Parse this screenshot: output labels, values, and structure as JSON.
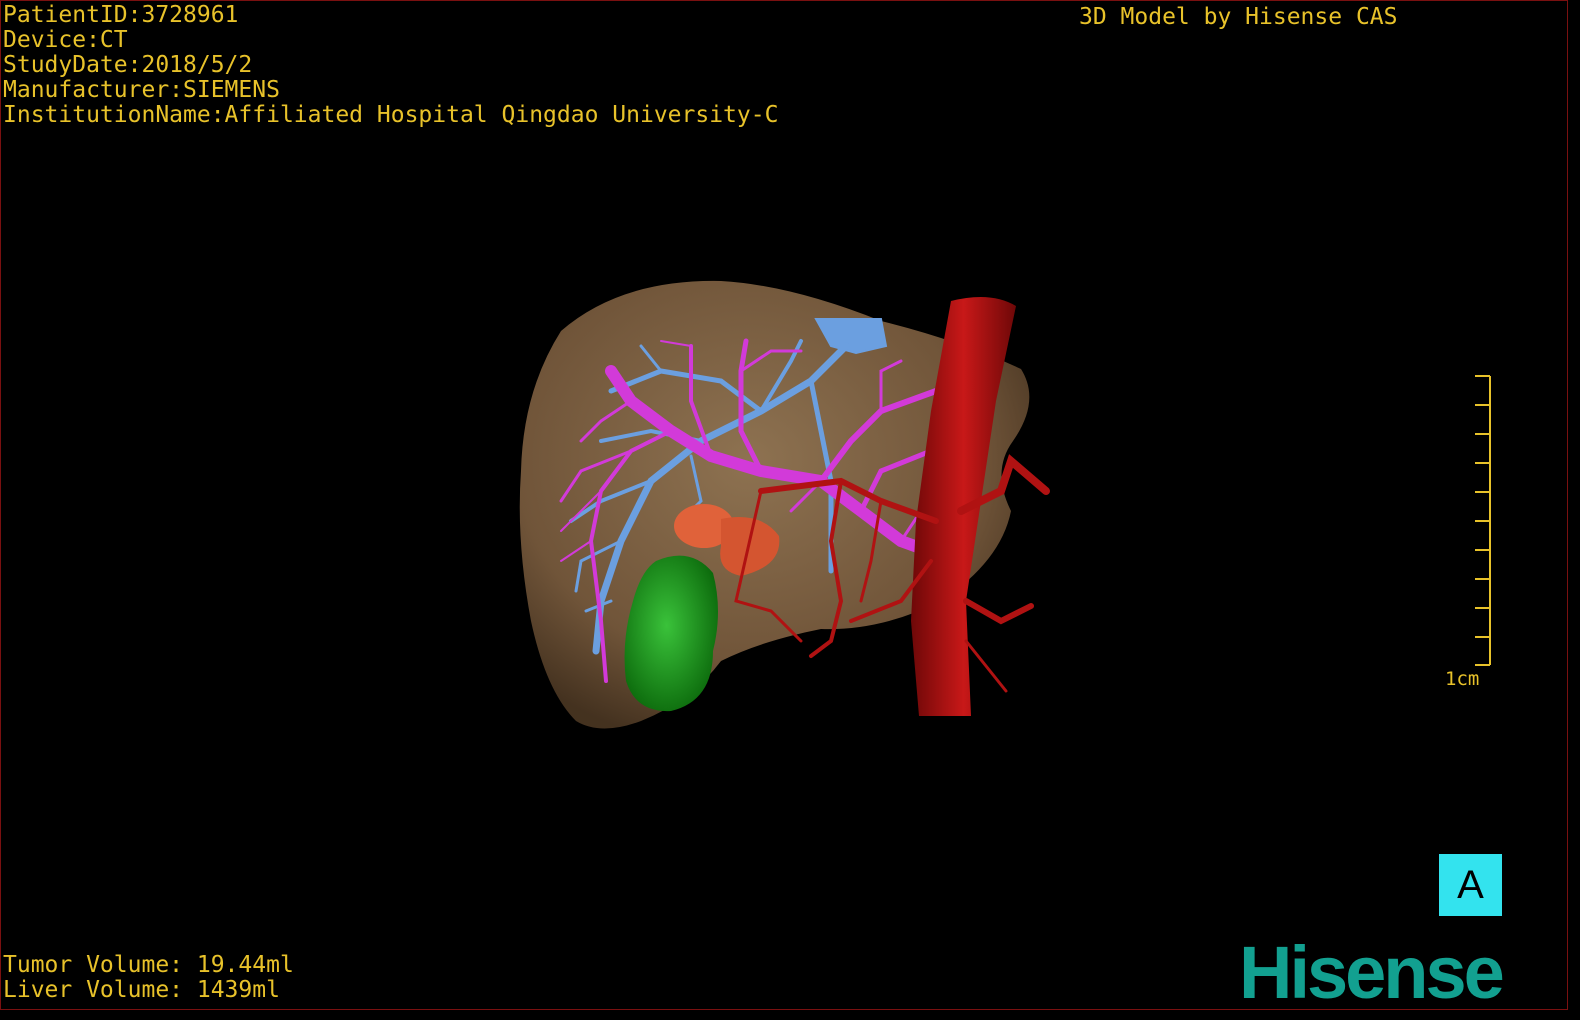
{
  "header": {
    "patient_id": "PatientID:3728961",
    "device": "Device:CT",
    "study_date": "StudyDate:2018/5/2",
    "manufacturer": "Manufacturer:SIEMENS",
    "institution": "InstitutionName:Affiliated Hospital Qingdao University-C",
    "credit": "3D Model by Hisense CAS"
  },
  "scale_bar": {
    "label": "1cm"
  },
  "view_badge": {
    "label": "A"
  },
  "volumes": {
    "tumor": "Tumor Volume: 19.44ml",
    "liver": "Liver Volume: 1439ml"
  },
  "brand": {
    "logo_text": "Hisense"
  },
  "colors": {
    "background": "#000000",
    "overlay_text": "#e8c22a",
    "liver": "#8a6a48",
    "portal_vein": "#6b9fe0",
    "hepatic_vein": "#d23ad9",
    "artery": "#b01212",
    "tumor": "#e0623a",
    "gallbladder": "#1e9a1e",
    "badge": "#33e3ee",
    "logo": "#12a090"
  },
  "structures": [
    "liver",
    "portal-vein",
    "hepatic-vein",
    "artery",
    "tumor",
    "gallbladder"
  ]
}
